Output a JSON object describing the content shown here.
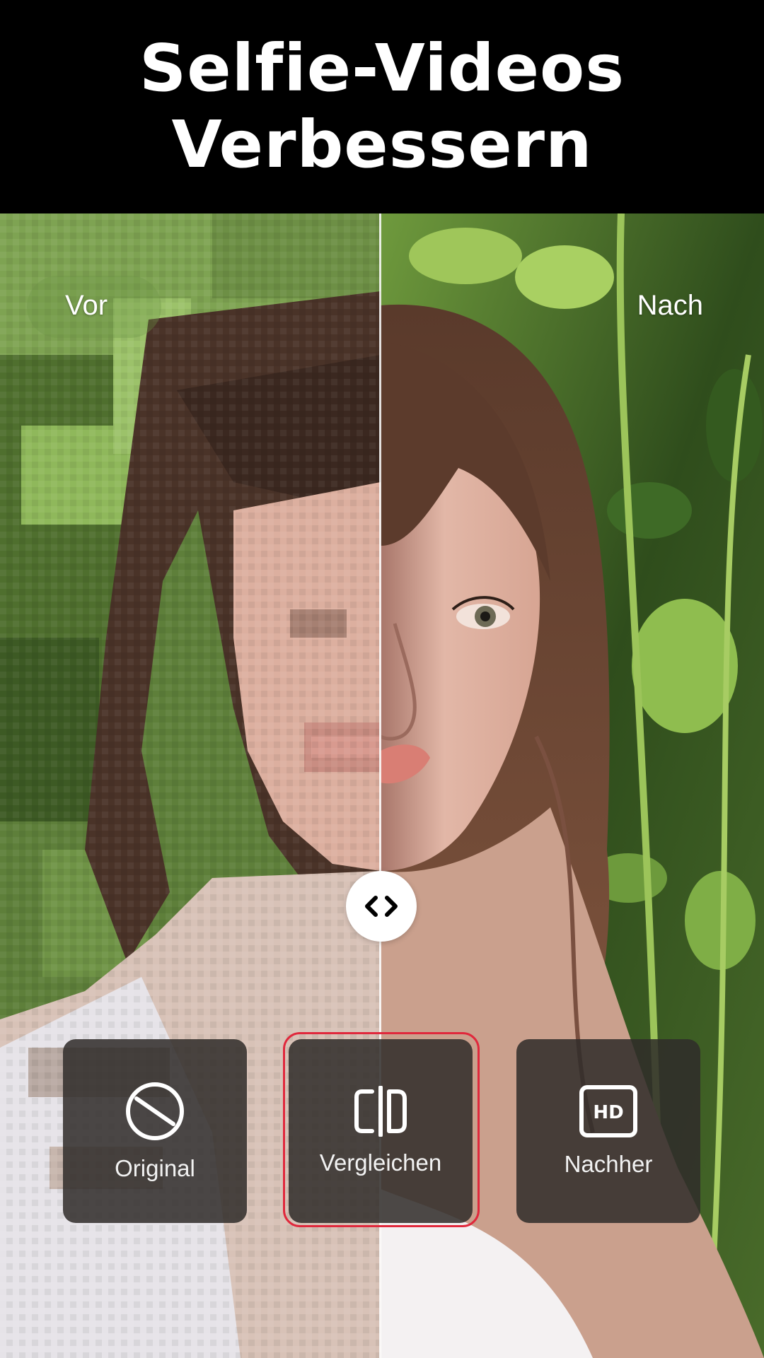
{
  "header": {
    "title_line1": "Selfie-Videos",
    "title_line2": "Verbessern"
  },
  "compare": {
    "before_label": "Vor",
    "after_label": "Nach",
    "handle_icon": "chevron-left-right-icon"
  },
  "modes": [
    {
      "label": "Original",
      "icon": "no-entry-icon",
      "selected": false
    },
    {
      "label": "Vergleichen",
      "icon": "compare-split-icon",
      "selected": true
    },
    {
      "label": "Nachher",
      "icon": "hd-icon",
      "selected": false
    }
  ],
  "colors": {
    "selected_ring": "#e0283c",
    "header_bg": "#000000",
    "button_bg": "#302c2a"
  }
}
